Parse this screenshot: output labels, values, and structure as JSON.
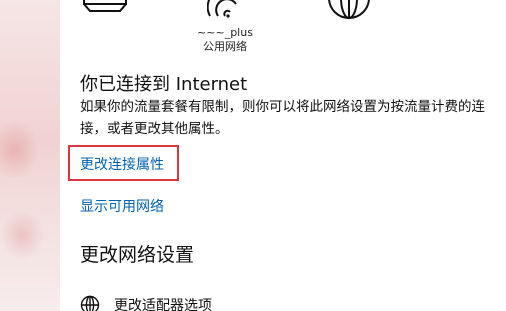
{
  "network_status": {
    "network_name": "~~~_plus",
    "network_type": "公用网络"
  },
  "internet": {
    "heading": "你已连接到 Internet",
    "description": "如果你的流量套餐有限制，则你可以将此网络设置为按流量计费的连接，或者更改其他属性。"
  },
  "links": {
    "change_connection_properties": "更改连接属性",
    "show_available_networks": "显示可用网络"
  },
  "change_network_settings": {
    "title": "更改网络设置",
    "adapter_options": "更改适配器选项"
  },
  "colors": {
    "link": "#0063b1",
    "highlight_box": "#d9363e"
  },
  "icons": [
    "computer-icon",
    "wifi-icon",
    "globe-icon",
    "adapter-globe-icon"
  ]
}
